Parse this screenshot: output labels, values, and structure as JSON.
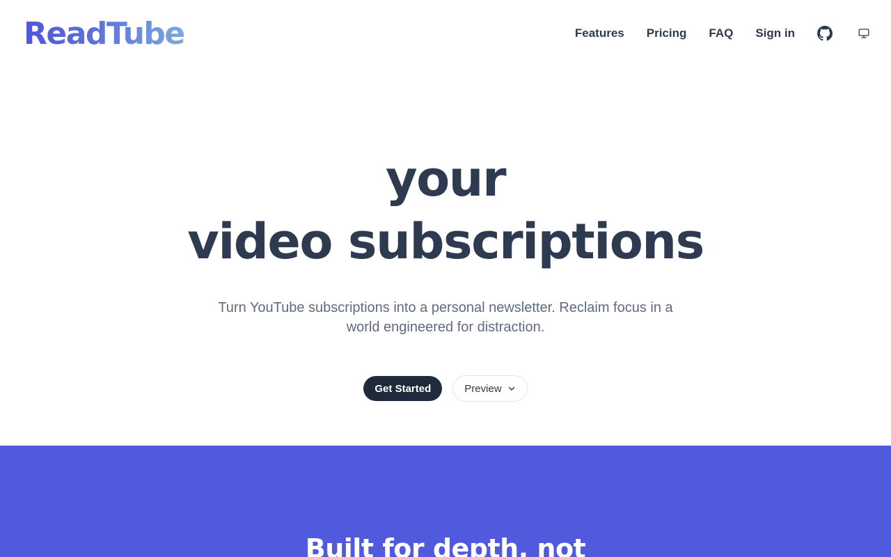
{
  "brand": {
    "logo_text": "ReadTube",
    "gradient_start": "#4f56d8",
    "gradient_end": "#7aa8e0"
  },
  "nav": {
    "items": [
      {
        "label": "Features"
      },
      {
        "label": "Pricing"
      },
      {
        "label": "FAQ"
      },
      {
        "label": "Sign in"
      }
    ],
    "icons": [
      "github-icon",
      "monitor-icon"
    ]
  },
  "hero": {
    "title_line1": "your",
    "title_line2": "video subscriptions",
    "subtitle": "Turn YouTube subscriptions into a personal newsletter. Reclaim focus in a world engineered for distraction.",
    "primary_cta": "Get Started",
    "secondary_cta": "Preview"
  },
  "feature_band": {
    "title": "Built for depth, not",
    "background": "#5159dd"
  },
  "colors": {
    "text_dark": "#2e3a50",
    "text_muted": "#5f6b80",
    "button_dark": "#1f2a3c"
  }
}
